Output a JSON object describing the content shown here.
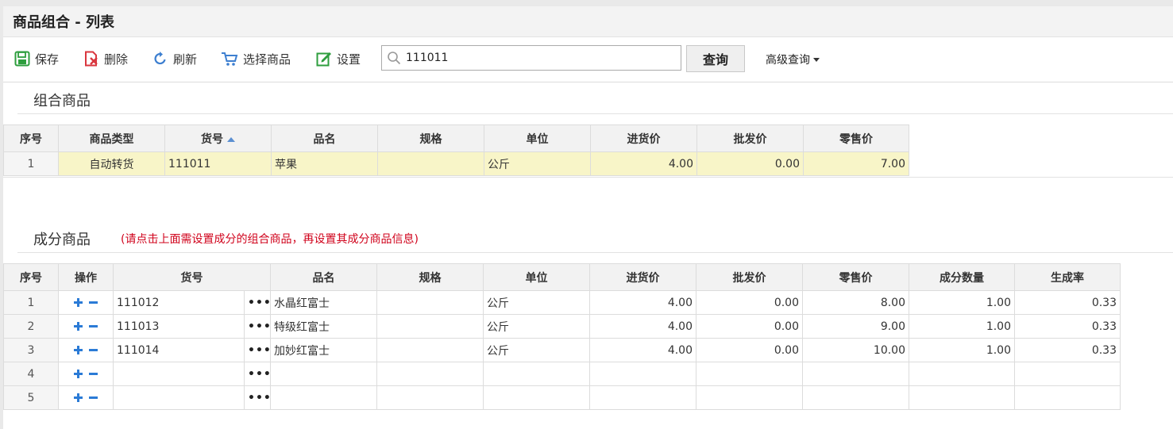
{
  "window": {
    "title": "商品组合 - 列表"
  },
  "toolbar": {
    "save": "保存",
    "delete": "删除",
    "refresh": "刷新",
    "select_goods": "选择商品",
    "settings": "设置",
    "search_value": "111011",
    "query": "查询",
    "advanced": "高级查询"
  },
  "combo": {
    "title": "组合商品",
    "headers": [
      "序号",
      "商品类型",
      "货号",
      "品名",
      "规格",
      "单位",
      "进货价",
      "批发价",
      "零售价"
    ],
    "rows": [
      {
        "idx": "1",
        "type": "自动转货",
        "code": "111011",
        "name": "苹果",
        "spec": "",
        "unit": "公斤",
        "purchase": "4.00",
        "wholesale": "0.00",
        "retail": "7.00"
      }
    ]
  },
  "component": {
    "title": "成分商品",
    "hint": "(请点击上面需设置成分的组合商品，再设置其成分商品信息)",
    "headers": [
      "序号",
      "操作",
      "货号",
      "品名",
      "规格",
      "单位",
      "进货价",
      "批发价",
      "零售价",
      "成分数量",
      "生成率"
    ],
    "rows": [
      {
        "idx": "1",
        "code": "111012",
        "name": "水晶红富士",
        "spec": "",
        "unit": "公斤",
        "purchase": "4.00",
        "wholesale": "0.00",
        "retail": "8.00",
        "qty": "1.00",
        "rate": "0.33"
      },
      {
        "idx": "2",
        "code": "111013",
        "name": "特级红富士",
        "spec": "",
        "unit": "公斤",
        "purchase": "4.00",
        "wholesale": "0.00",
        "retail": "9.00",
        "qty": "1.00",
        "rate": "0.33"
      },
      {
        "idx": "3",
        "code": "111014",
        "name": "加妙红富士",
        "spec": "",
        "unit": "公斤",
        "purchase": "4.00",
        "wholesale": "0.00",
        "retail": "10.00",
        "qty": "1.00",
        "rate": "0.33"
      },
      {
        "idx": "4",
        "code": "",
        "name": "",
        "spec": "",
        "unit": "",
        "purchase": "",
        "wholesale": "",
        "retail": "",
        "qty": "",
        "rate": ""
      },
      {
        "idx": "5",
        "code": "",
        "name": "",
        "spec": "",
        "unit": "",
        "purchase": "",
        "wholesale": "",
        "retail": "",
        "qty": "",
        "rate": ""
      }
    ]
  },
  "colors": {
    "accent": "#2b7bd6",
    "hint": "#d0021b",
    "selected_row": "#f8f5c8"
  }
}
